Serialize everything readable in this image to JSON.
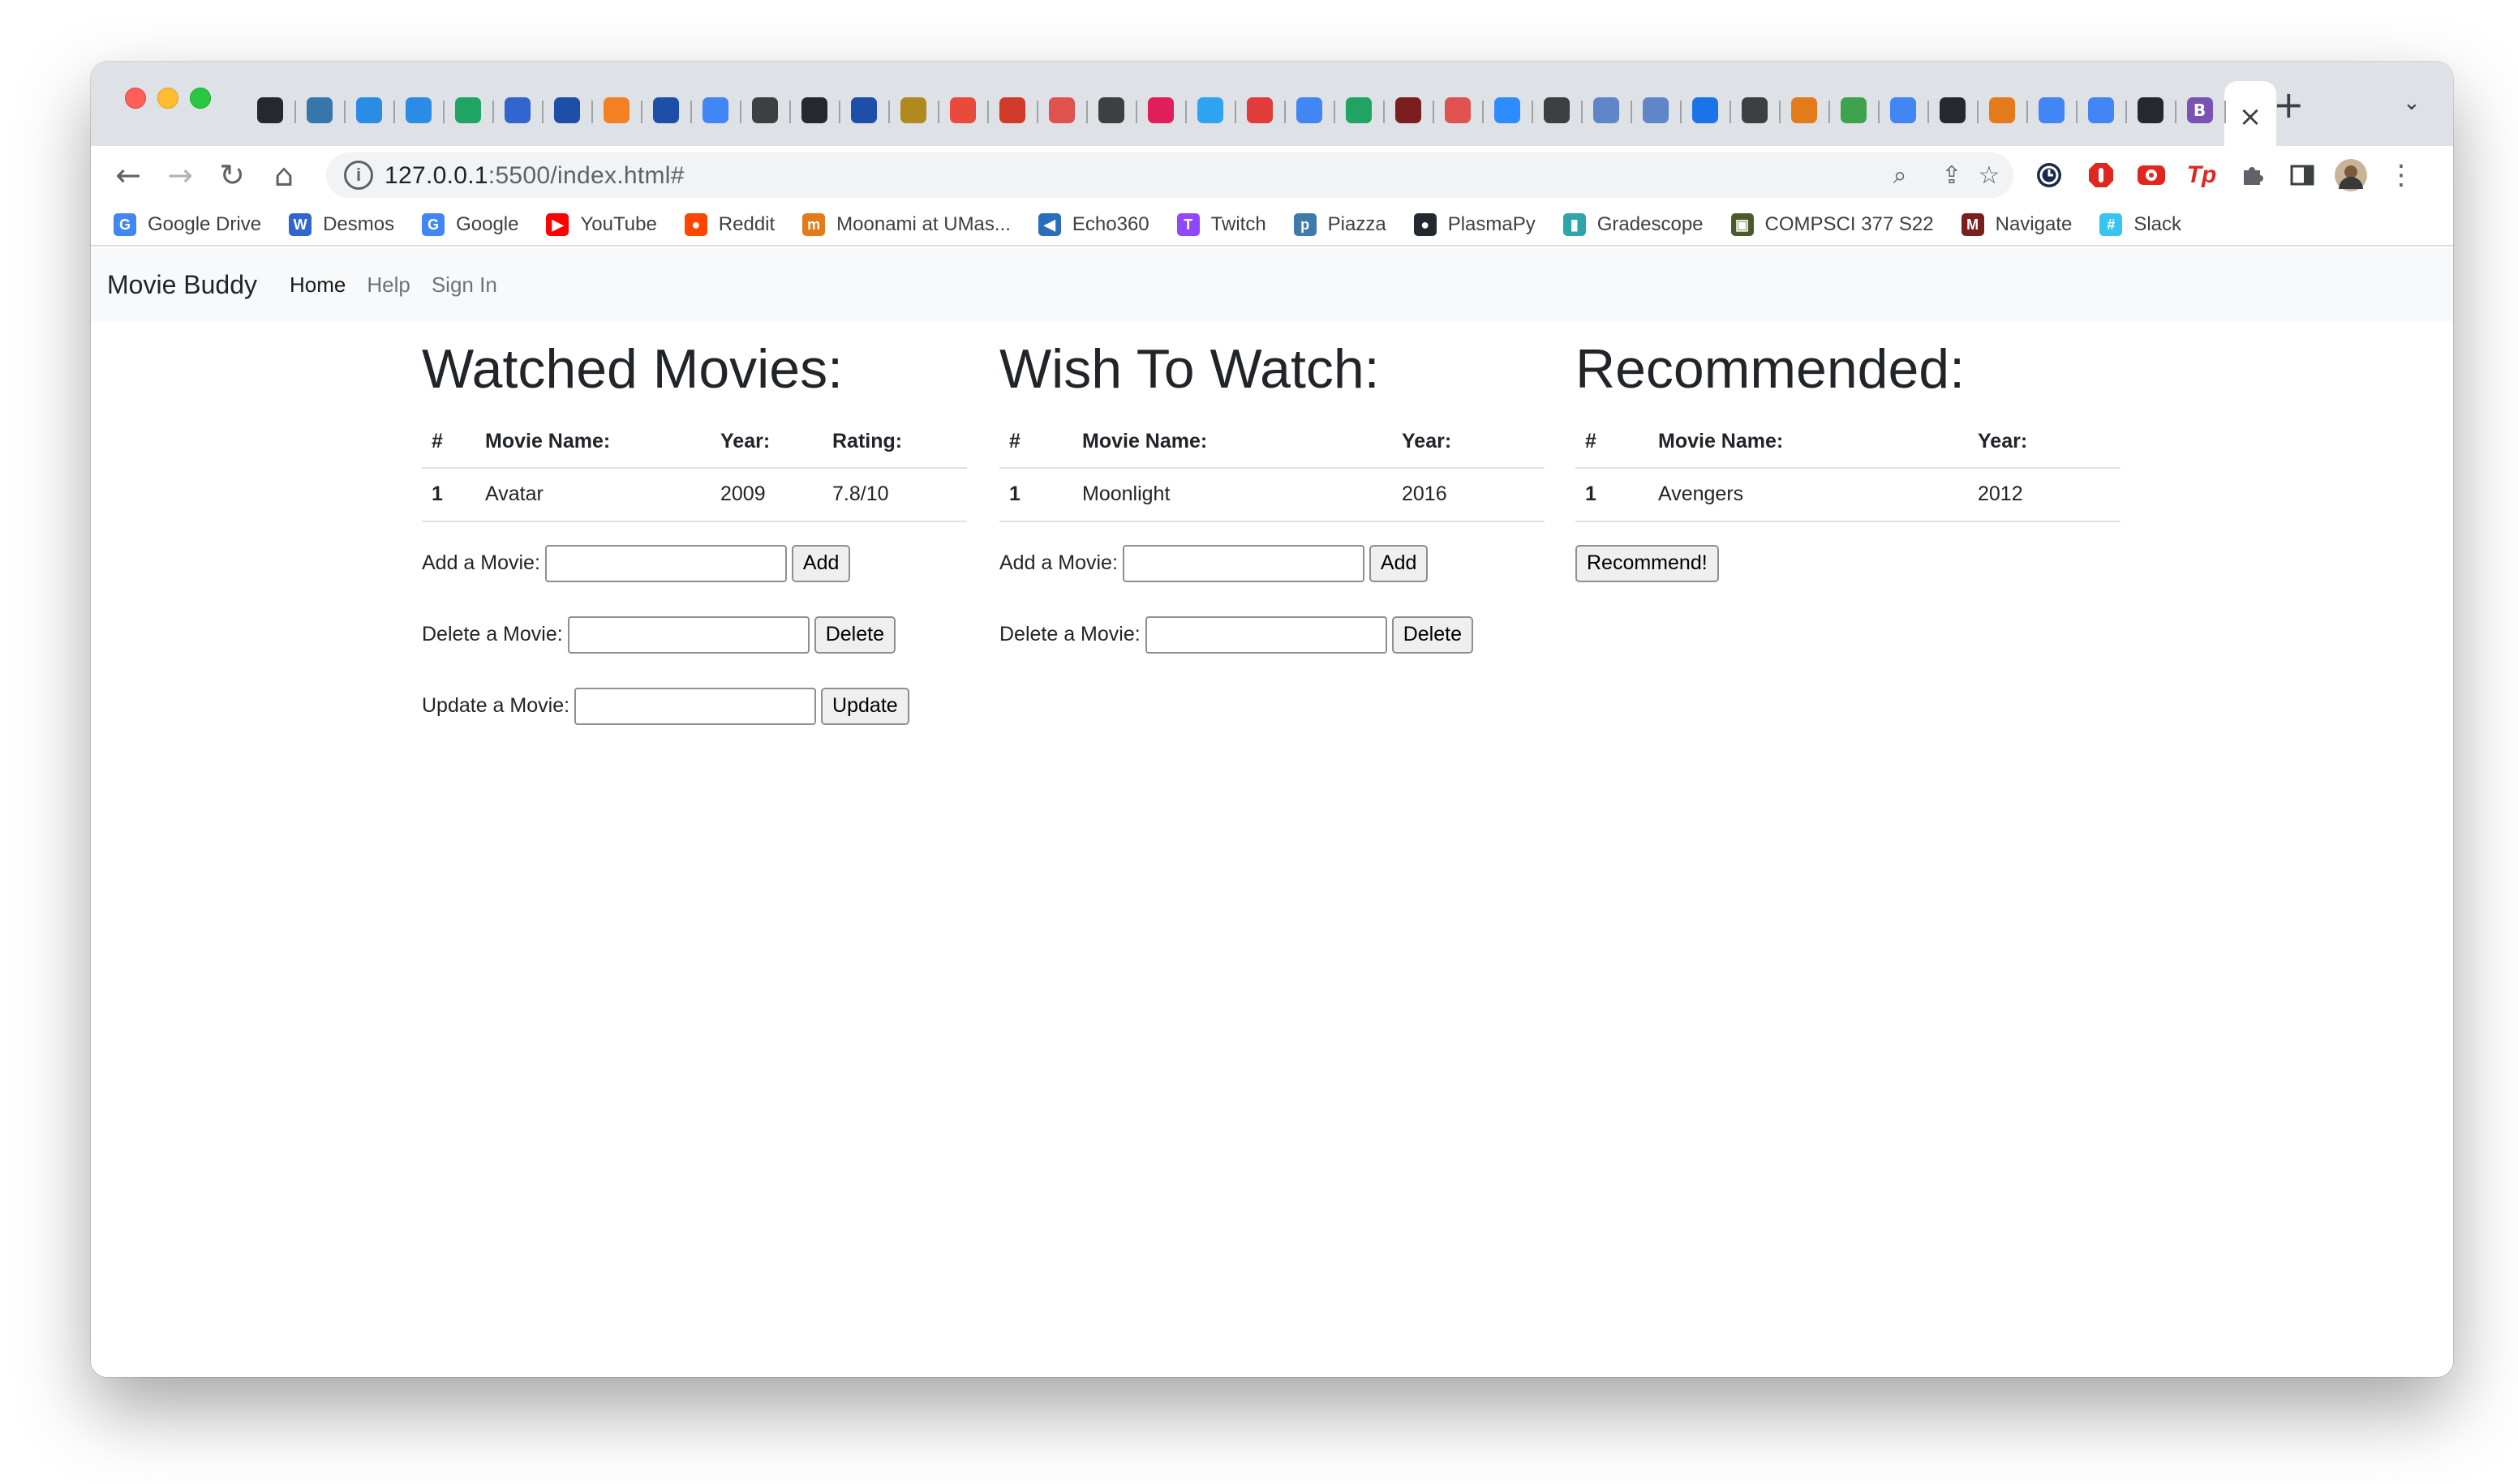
{
  "browser": {
    "tabs": [
      {
        "icon": "github-icon",
        "color": "#24292f"
      },
      {
        "icon": "python-icon",
        "color": "#3776ab"
      },
      {
        "icon": "swift-icon",
        "color": "#2b8ce6"
      },
      {
        "icon": "swift-icon",
        "color": "#2b8ce6"
      },
      {
        "icon": "google-drive-icon",
        "color": "#1fa463"
      },
      {
        "icon": "desmos-icon",
        "color": "#3165cf"
      },
      {
        "icon": "sketch-icon",
        "color": "#1d4fa8"
      },
      {
        "icon": "stackoverflow-icon",
        "color": "#f48024"
      },
      {
        "icon": "sketch-icon",
        "color": "#1d4fa8"
      },
      {
        "icon": "google-icon",
        "color": "#4285f4"
      },
      {
        "icon": "globe-icon",
        "color": "#3c4043"
      },
      {
        "icon": "github-icon",
        "color": "#24292f"
      },
      {
        "icon": "globe-icon",
        "color": "#1d4fa8"
      },
      {
        "icon": "bee-icon",
        "color": "#b08a1e"
      },
      {
        "icon": "pinwheel-icon",
        "color": "#e84b3c"
      },
      {
        "icon": "eye-icon",
        "color": "#d03a2a"
      },
      {
        "icon": "leaf-icon",
        "color": "#e0524e"
      },
      {
        "icon": "globe-icon",
        "color": "#3c4043"
      },
      {
        "icon": "slack-icon",
        "color": "#e01e5a"
      },
      {
        "icon": "codepen-icon",
        "color": "#2ea3f2"
      },
      {
        "icon": "calendar-icon",
        "color": "#e23b3b"
      },
      {
        "icon": "docs-icon",
        "color": "#4285f4"
      },
      {
        "icon": "google-drive-icon",
        "color": "#1fa463"
      },
      {
        "icon": "m-icon",
        "color": "#7a1e1e"
      },
      {
        "icon": "leaf-icon",
        "color": "#e0524e"
      },
      {
        "icon": "zoom-icon",
        "color": "#2d8cff"
      },
      {
        "icon": "error-icon",
        "color": "#3c4043"
      },
      {
        "icon": "cube-icon",
        "color": "#5f86c9"
      },
      {
        "icon": "cube-icon",
        "color": "#5f86c9"
      },
      {
        "icon": "code-icon",
        "color": "#1a73e8"
      },
      {
        "icon": "globe-icon",
        "color": "#3c4043"
      },
      {
        "icon": "moonami-icon",
        "color": "#e37b1b"
      },
      {
        "icon": "github-icon",
        "color": "#3fa34d"
      },
      {
        "icon": "docs-icon",
        "color": "#4285f4"
      },
      {
        "icon": "github-icon",
        "color": "#24292f"
      },
      {
        "icon": "moonami-icon",
        "color": "#e37b1b"
      },
      {
        "icon": "docs-icon",
        "color": "#4285f4"
      },
      {
        "icon": "docs-icon",
        "color": "#4285f4"
      },
      {
        "icon": "github-icon",
        "color": "#24292f"
      },
      {
        "icon": "bootstrap-icon",
        "color": "#7952b3",
        "letter": "B"
      }
    ],
    "url_host": "127.0.0.1",
    "url_rest": ":5500/index.html#",
    "bookmarks": [
      {
        "label": "Google Drive",
        "icon": "google-icon",
        "color": "#4285f4",
        "letter": "G"
      },
      {
        "label": "Desmos",
        "icon": "desmos-icon",
        "color": "#3165cf",
        "letter": "W"
      },
      {
        "label": "Google",
        "icon": "google-icon",
        "color": "#4285f4",
        "letter": "G"
      },
      {
        "label": "YouTube",
        "icon": "youtube-icon",
        "color": "#ff0000",
        "letter": "▶"
      },
      {
        "label": "Reddit",
        "icon": "reddit-icon",
        "color": "#ff4500",
        "letter": "●"
      },
      {
        "label": "Moonami at UMas...",
        "icon": "moonami-icon",
        "color": "#e37b1b",
        "letter": "m"
      },
      {
        "label": "Echo360",
        "icon": "echo360-icon",
        "color": "#2a6ebb",
        "letter": "◀"
      },
      {
        "label": "Twitch",
        "icon": "twitch-icon",
        "color": "#9146ff",
        "letter": "T"
      },
      {
        "label": "Piazza",
        "icon": "piazza-icon",
        "color": "#3e7aab",
        "letter": "p"
      },
      {
        "label": "PlasmaPy",
        "icon": "github-icon",
        "color": "#24292f",
        "letter": "●"
      },
      {
        "label": "Gradescope",
        "icon": "bar-chart-icon",
        "color": "#2fa4a9",
        "letter": "▮"
      },
      {
        "label": "COMPSCI 377 S22",
        "icon": "photo-icon",
        "color": "#4b5a2a",
        "letter": "▣"
      },
      {
        "label": "Navigate",
        "icon": "m-icon",
        "color": "#7a1e1e",
        "letter": "M"
      },
      {
        "label": "Slack",
        "icon": "slack-icon",
        "color": "#36c5f0",
        "letter": "#"
      }
    ]
  },
  "nav": {
    "brand": "Movie Buddy",
    "links": [
      "Home",
      "Help",
      "Sign In"
    ]
  },
  "watched": {
    "title": "Watched Movies:",
    "headers": [
      "#",
      "Movie Name:",
      "Year:",
      "Rating:"
    ],
    "rows": [
      [
        "1",
        "Avatar",
        "2009",
        "7.8/10"
      ]
    ],
    "add_label": "Add a Movie:",
    "add_button": "Add",
    "delete_label": "Delete a Movie:",
    "delete_button": "Delete",
    "update_label": "Update a Movie:",
    "update_button": "Update"
  },
  "wish": {
    "title": "Wish To Watch:",
    "headers": [
      "#",
      "Movie Name:",
      "Year:"
    ],
    "rows": [
      [
        "1",
        "Moonlight",
        "2016"
      ]
    ],
    "add_label": "Add a Movie:",
    "add_button": "Add",
    "delete_label": "Delete a Movie:",
    "delete_button": "Delete"
  },
  "recommended": {
    "title": "Recommended:",
    "headers": [
      "#",
      "Movie Name:",
      "Year:"
    ],
    "rows": [
      [
        "1",
        "Avengers",
        "2012"
      ]
    ],
    "button": "Recommend!"
  }
}
